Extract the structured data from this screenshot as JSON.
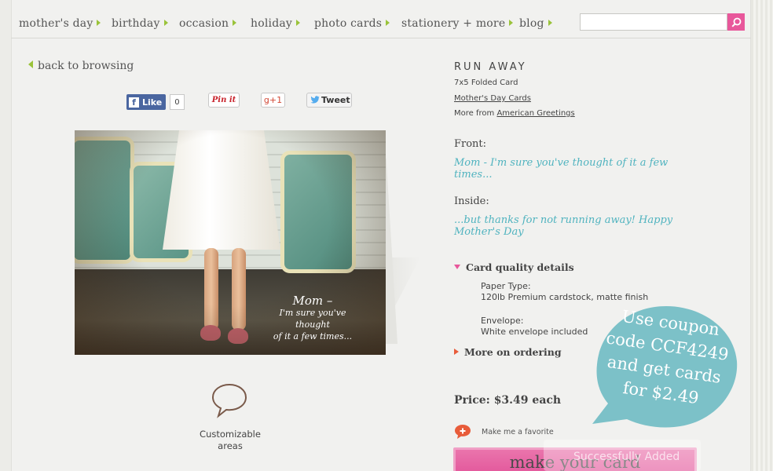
{
  "nav": {
    "items": [
      "mother's day",
      "birthday",
      "occasion",
      "holiday",
      "photo cards",
      "stationery + more",
      "blog"
    ],
    "search_placeholder": ""
  },
  "back_link": "back to browsing",
  "social": {
    "like": "Like",
    "like_count": "0",
    "pin": "Pin it",
    "gplus": "+1",
    "tweet": "Tweet"
  },
  "card_art_text": {
    "line1": "Mom –",
    "line2": "I'm sure you've thought",
    "line3": "of it a few times..."
  },
  "customizable_label": "Customizable areas",
  "product": {
    "title": "RUN AWAY",
    "format": "7x5 Folded Card",
    "category_link": "Mother's Day Cards",
    "more_from_prefix": "More from",
    "more_from_link": "American Greetings",
    "front_label": "Front:",
    "front_text": "Mom - I'm sure you've thought of it a few times...",
    "inside_label": "Inside:",
    "inside_text": "...but thanks for not running away! Happy Mother's Day",
    "quality_label": "Card quality details",
    "paper_type_label": "Paper Type:",
    "paper_type_value": "120lb Premium cardstock, matte finish",
    "envelope_label": "Envelope:",
    "envelope_value": "White envelope included",
    "ordering_label": "More on ordering",
    "price": "Price: $3.49 each",
    "favorite_label": "Make me a favorite",
    "make_button": "make your card",
    "overlay_text": "Successfully Added"
  },
  "coupon": {
    "line1": "Use coupon",
    "line2": "code CCF4249",
    "line3": "and get cards",
    "line4": "for $2.49"
  },
  "colors": {
    "accent_pink": "#e8579b",
    "accent_green": "#9ac33a",
    "teal_text": "#4fb3bf",
    "coupon_bubble": "#7cc1c8"
  }
}
